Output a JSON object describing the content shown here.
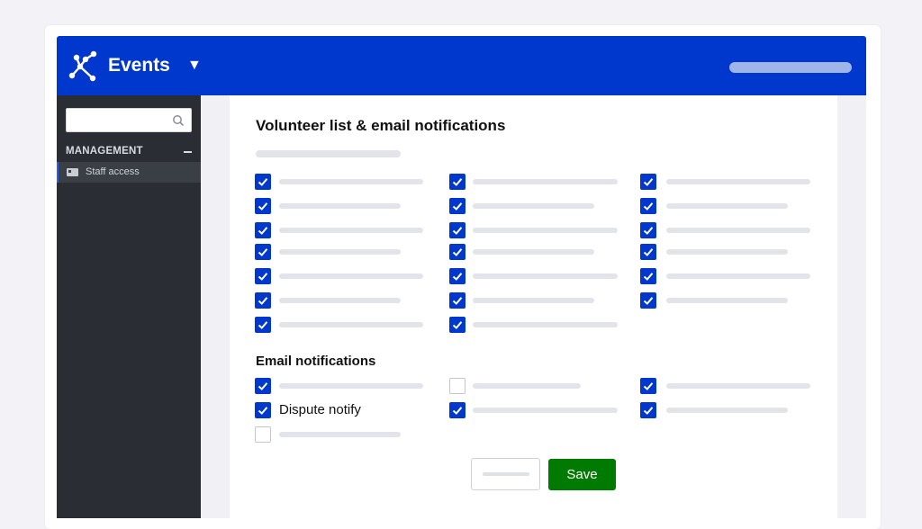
{
  "app": {
    "title": "Events",
    "dropdown_icon": "caret-down-icon"
  },
  "sidebar": {
    "search": {
      "value": "",
      "placeholder": ""
    },
    "section": "MANAGEMENT",
    "items": [
      {
        "label": "Staff access",
        "icon": "id-card-icon"
      }
    ]
  },
  "page": {
    "title": "Volunteer list & email notifications",
    "email_section_title": "Email notifications",
    "dispute_label": "Dispute notify",
    "save_label": "Save",
    "cancel_label": ""
  },
  "volunteer_checkboxes": [
    [
      true,
      true,
      true,
      true,
      true,
      true,
      true
    ],
    [
      true,
      true,
      true,
      true,
      true,
      true,
      true
    ],
    [
      true,
      true,
      true,
      true,
      true,
      true
    ]
  ],
  "email_checkboxes": [
    [
      true,
      true,
      false
    ],
    [
      false,
      true
    ],
    [
      true,
      true
    ]
  ],
  "colors": {
    "brand": "#0037cc",
    "save": "#007a00",
    "sidebar": "#2a2d33"
  }
}
